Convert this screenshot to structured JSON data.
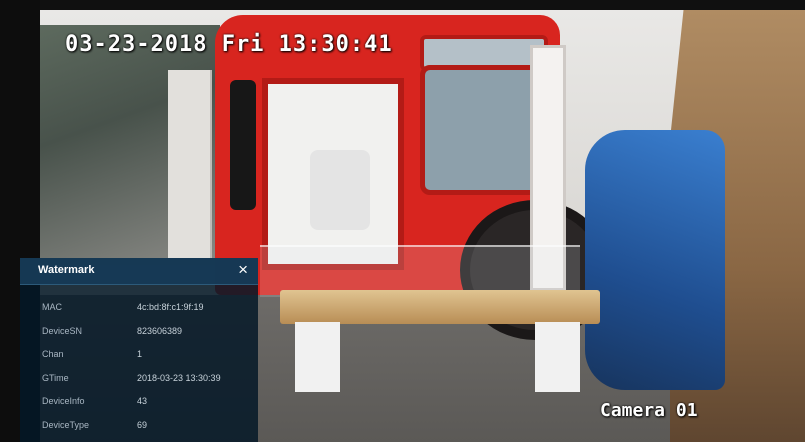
{
  "overlay": {
    "timestamp": "03-23-2018 Fri 13:30:41",
    "camera_name": "Camera 01"
  },
  "watermark_panel": {
    "title": "Watermark",
    "close_glyph": "×",
    "rows": [
      {
        "key": "MAC",
        "value": "4c:bd:8f:c1:9f:19"
      },
      {
        "key": "DeviceSN",
        "value": "823606389"
      },
      {
        "key": "Chan",
        "value": "1"
      },
      {
        "key": "GTime",
        "value": "2018-03-23 13:30:39"
      },
      {
        "key": "DeviceInfo",
        "value": "43"
      },
      {
        "key": "DeviceType",
        "value": "69"
      }
    ]
  },
  "colors": {
    "panel_bg": "#051828",
    "panel_header": "#163a56",
    "bus_red": "#d8251f",
    "car_blue": "#2f6fbf"
  }
}
